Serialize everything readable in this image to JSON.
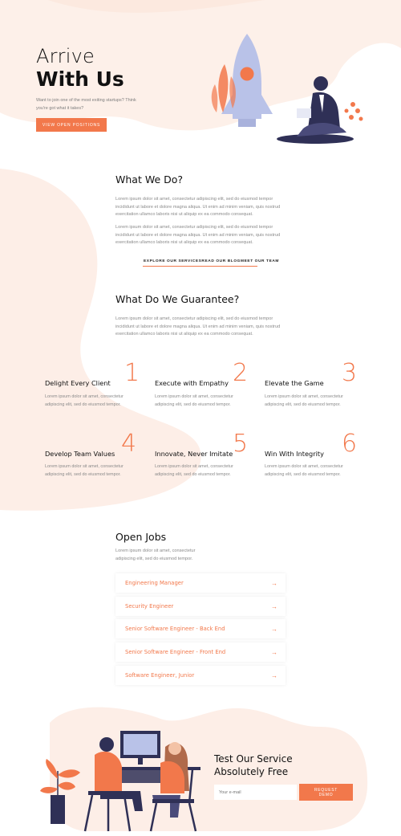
{
  "colors": {
    "accent": "#f2784b",
    "blob": "#fdeee7",
    "text": "#111111",
    "muted": "#8a8a8a",
    "navy": "#2f3056"
  },
  "hero": {
    "title_line1": "Arrive",
    "title_line2": "With Us",
    "subtitle": "Want to join one of the most exiting startups? Think you're got what it takes?",
    "button_label": "VIEW OPEN POSITIONS"
  },
  "what_we_do": {
    "heading": "What We Do?",
    "paragraph1": "Lorem ipsum dolor sit amet, consectetur adipiscing elit, sed do eiusmod tempor incididunt ut labore et dolore magna aliqua. Ut enim ad minim veniam, quis nostrud exercitation ullamco laboris nisi ut aliquip ex ea commodo consequat.",
    "paragraph2": "Lorem ipsum dolor sit amet, consectetur adipiscing elit, sed do eiusmod tempor incididunt ut labore et dolore magna aliqua. Ut enim ad minim veniam, quis nostrud exercitation ullamco laboris nisi ut aliquip ex ea commodo consequat.",
    "links": "EXPLORE OUR SERVICESREAD OUR BLOGMEET OUR TEAM"
  },
  "guarantee": {
    "heading": "What Do We Guarantee?",
    "paragraph": "Lorem ipsum dolor sit amet, consectetur adipiscing elit, sed do eiusmod tempor incididunt ut labore et dolore magna aliqua. Ut enim ad minim veniam, quis nostrud exercitation ullamco laboris nisi ut aliquip ex ea commodo consequat.",
    "items": [
      {
        "title": "Delight Every Client",
        "number": "1",
        "text": "Lorem ipsum dolor sit amet, consectetur adipiscing elit, sed do eiusmod tempor."
      },
      {
        "title": "Execute with Empathy",
        "number": "2",
        "text": "Lorem ipsum dolor sit amet, consectetur adipiscing elit, sed do eiusmod tempor."
      },
      {
        "title": "Elevate the Game",
        "number": "3",
        "text": "Lorem ipsum dolor sit amet, consectetur adipiscing elit, sed do eiusmod tempor."
      },
      {
        "title": "Develop Team Values",
        "number": "4",
        "text": "Lorem ipsum dolor sit amet, consectetur adipiscing elit, sed do eiusmod tempor."
      },
      {
        "title": "Innovate, Never Imitate",
        "number": "5",
        "text": "Lorem ipsum dolor sit amet, consectetur adipiscing elit, sed do eiusmod tempor."
      },
      {
        "title": "Win With Integrity",
        "number": "6",
        "text": "Lorem ipsum dolor sit amet, consectetur adipiscing elit, sed do eiusmod tempor."
      }
    ]
  },
  "jobs": {
    "heading": "Open Jobs",
    "intro": "Lorem ipsum dolor sit amet, consectetur adipiscing elit, sed do eiusmod tempor.",
    "items": [
      {
        "label": "Engineering Manager"
      },
      {
        "label": "Security Engineer"
      },
      {
        "label": "Senior Software Engineer - Back End"
      },
      {
        "label": "Senior Software Engineer - Front End"
      },
      {
        "label": "Software Engineer, Junior"
      }
    ],
    "arrow_icon": "arrow-right-icon"
  },
  "cta": {
    "title_line1": "Test Our Service",
    "title_line2": "Absolutely Free",
    "email_placeholder": "Your e-mail",
    "button_line1": "REQUEST",
    "button_line2": "DEMO"
  }
}
